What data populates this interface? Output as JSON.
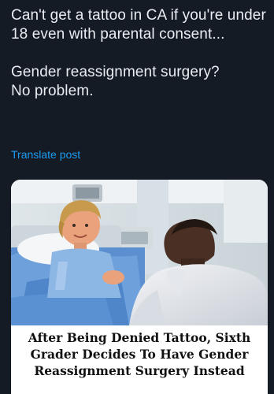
{
  "post": {
    "paragraph1": "Can't get a tattoo in CA if you're under 18 even with parental consent...",
    "paragraph2_line1": "Gender reassignment surgery?",
    "paragraph2_line2": "No problem.",
    "translate_label": "Translate post"
  },
  "article": {
    "headline_lines": [
      "After Being Denied Tattoo, Sixth",
      "Grader Decides To Have Gender",
      "Reassignment Surgery Instead"
    ]
  }
}
